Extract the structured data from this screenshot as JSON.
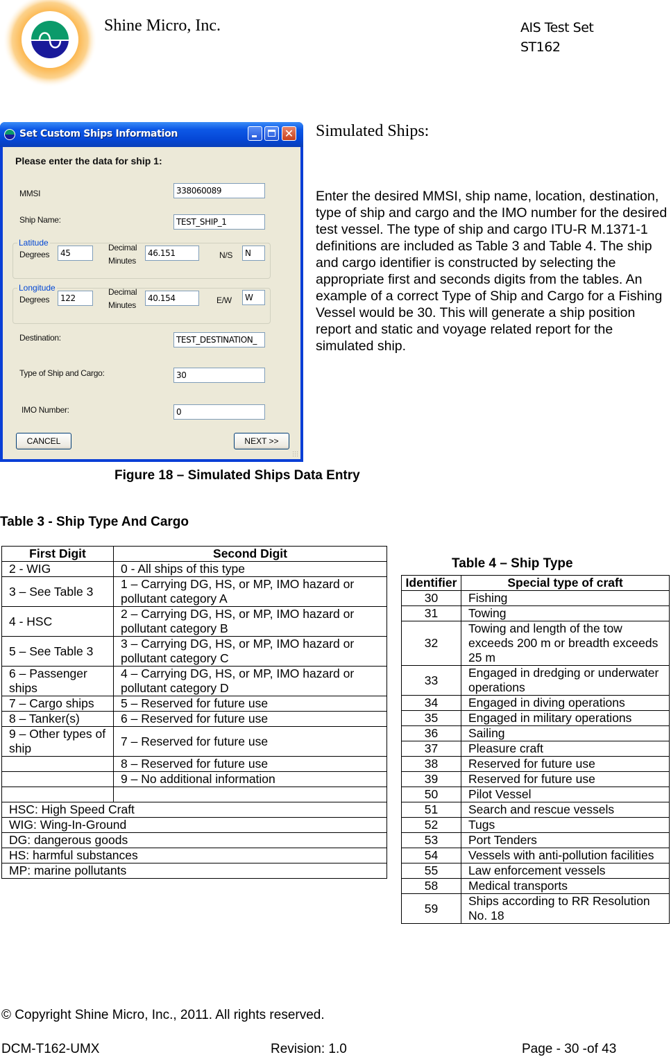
{
  "header": {
    "company": "Shine Micro, Inc.",
    "product_line1": "AIS Test Set",
    "product_line2": "ST162",
    "logo_colors": {
      "glow": "#fbb040",
      "top": "#0b9a6a",
      "bottom": "#1a1a9a"
    }
  },
  "dialog": {
    "title": "Set Custom Ships Information",
    "prompt": "Please enter the data for ship 1:",
    "mmsi_label": "MMSI",
    "mmsi_value": "338060089",
    "ship_name_label": "Ship Name:",
    "ship_name_value": "TEST_SHIP_1",
    "latitude": {
      "group_title": "Latitude",
      "degrees_label": "Degrees",
      "degrees_value": "45",
      "minutes_label_1": "Decimal",
      "minutes_label_2": "Minutes",
      "minutes_value": "46.151",
      "hemisphere_label": "N/S",
      "hemisphere_value": "N"
    },
    "longitude": {
      "group_title": "Longitude",
      "degrees_label": "Degrees",
      "degrees_value": "122",
      "minutes_label_1": "Decimal",
      "minutes_label_2": "Minutes",
      "minutes_value": "40.154",
      "hemisphere_label": "E/W",
      "hemisphere_value": "W"
    },
    "destination_label": "Destination:",
    "destination_value": "TEST_DESTINATION_",
    "type_label": "Type of Ship and Cargo:",
    "type_value": "30",
    "imo_label": "IMO Number:",
    "imo_value": "0",
    "cancel_label": "CANCEL",
    "next_label": "NEXT >>"
  },
  "section": {
    "heading": "Simulated Ships:",
    "body": "Enter the desired MMSI, ship name, location, destination, type of ship and cargo and the IMO number for the desired test vessel.  The type of ship and cargo ITU-R M.1371-1 definitions are included as Table 3 and Table 4. The ship and cargo identifier is constructed by selecting the appropriate first and seconds digits from the tables.  An example of a correct Type of Ship and Cargo for a Fishing Vessel would be 30. This will generate a ship position report and static and voyage related report for the simulated ship."
  },
  "figure_caption": "Figure 18 – Simulated Ships Data Entry",
  "table3": {
    "title": "Table 3 - Ship Type And Cargo",
    "headers": [
      "First Digit",
      "Second Digit"
    ],
    "rows": [
      [
        "2  - WIG",
        "0 - All ships of this type"
      ],
      [
        "3 – See Table 3",
        "1 – Carrying DG, HS, or MP, IMO hazard or pollutant category A"
      ],
      [
        "4 - HSC",
        "2 – Carrying DG, HS, or MP, IMO hazard or pollutant category B"
      ],
      [
        "5 – See Table 3",
        "3 – Carrying DG, HS, or MP, IMO hazard or pollutant category C"
      ],
      [
        "6 – Passenger ships",
        "4 – Carrying DG, HS, or MP, IMO hazard or pollutant category D"
      ],
      [
        "7 – Cargo ships",
        "5 – Reserved for future use"
      ],
      [
        "8 – Tanker(s)",
        "6 – Reserved for future use"
      ],
      [
        "9 – Other types of ship",
        "7 – Reserved for future use"
      ],
      [
        "",
        "8 –  Reserved for future use"
      ],
      [
        "",
        "9 – No additional information"
      ],
      [
        "",
        ""
      ]
    ],
    "notes": [
      "HSC: High Speed Craft",
      "WIG: Wing-In-Ground",
      "DG: dangerous goods",
      "HS: harmful substances",
      "MP: marine pollutants"
    ]
  },
  "table4": {
    "title": "Table 4 – Ship Type",
    "headers": [
      "Identifier",
      "Special type of craft"
    ],
    "rows": [
      [
        "30",
        "Fishing"
      ],
      [
        "31",
        "Towing"
      ],
      [
        "32",
        "Towing and length of the tow exceeds 200 m or breadth exceeds 25 m"
      ],
      [
        "33",
        "Engaged in dredging or underwater operations"
      ],
      [
        "34",
        "Engaged in diving operations"
      ],
      [
        "35",
        "Engaged in military operations"
      ],
      [
        "36",
        "Sailing"
      ],
      [
        "37",
        "Pleasure craft"
      ],
      [
        "38",
        "Reserved for future use"
      ],
      [
        "39",
        "Reserved for future use"
      ],
      [
        "50",
        "Pilot Vessel"
      ],
      [
        "51",
        "Search and rescue vessels"
      ],
      [
        "52",
        "Tugs"
      ],
      [
        "53",
        "Port Tenders"
      ],
      [
        "54",
        "Vessels with anti-pollution facilities"
      ],
      [
        "55",
        "Law enforcement vessels"
      ],
      [
        "58",
        "Medical transports"
      ],
      [
        "59",
        "Ships according to RR Resolution No. 18"
      ]
    ]
  },
  "footer": {
    "copyright": "© Copyright Shine Micro, Inc., 2011.  All rights reserved.",
    "doc_id": "DCM-T162-UMX",
    "revision": "Revision: 1.0",
    "page": "Page - 30 -of 43"
  }
}
